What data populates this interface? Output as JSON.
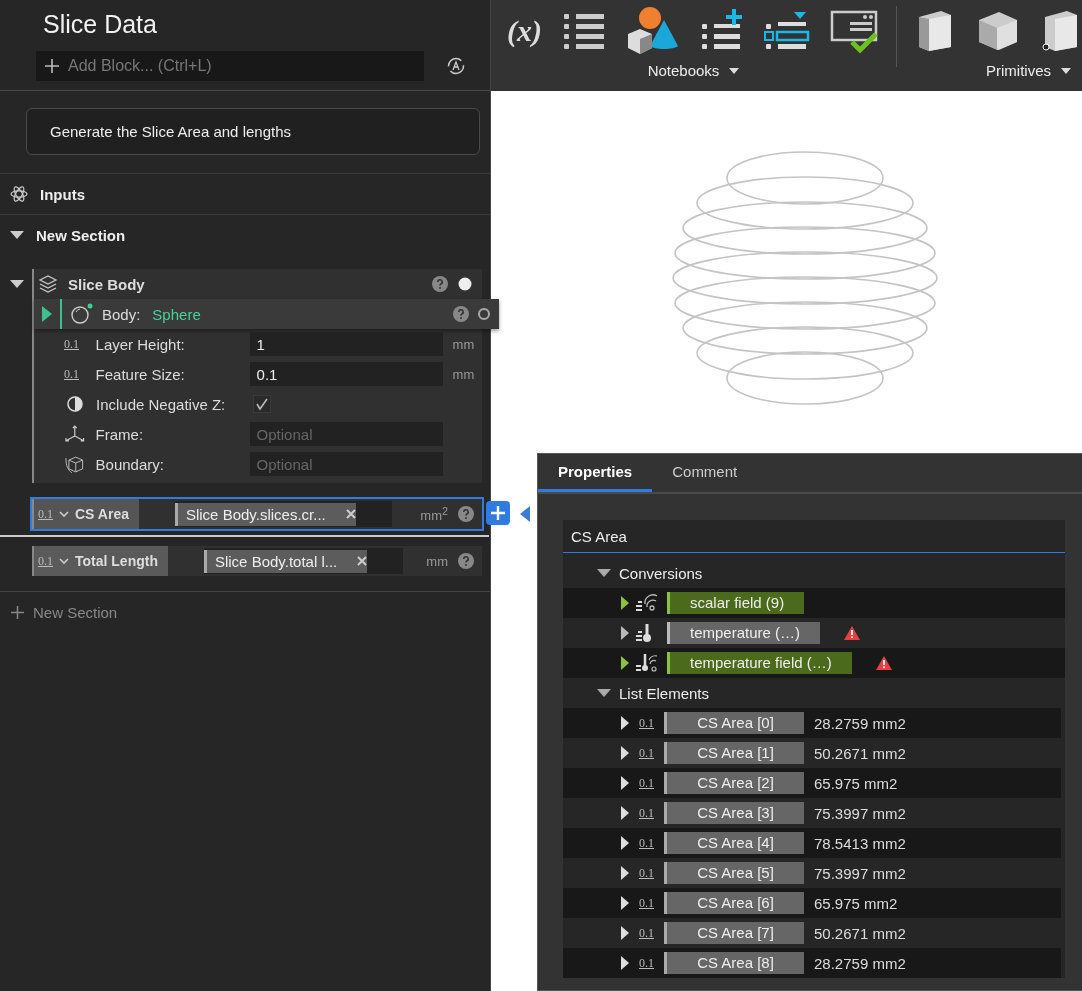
{
  "sidebar": {
    "title": "Slice Data",
    "add_block": {
      "placeholder": "Add Block... (Ctrl+L)"
    },
    "description": "Generate the Slice Area and lengths",
    "inputs_label": "Inputs",
    "section": {
      "title": "New Section",
      "expanded": true
    },
    "block": {
      "title": "Slice Body",
      "expanded": true,
      "body": {
        "label": "Body:",
        "value": "Sphere",
        "expanded": false
      },
      "params": [
        {
          "kind": "number",
          "icon": "0.1",
          "label": "Layer Height:",
          "value": "1",
          "unit": "mm"
        },
        {
          "kind": "number",
          "icon": "0.1",
          "label": "Feature Size:",
          "value": "0.1",
          "unit": "mm"
        },
        {
          "kind": "checkbox",
          "label": "Include Negative Z:",
          "checked": true
        },
        {
          "kind": "frame",
          "label": "Frame:",
          "placeholder": "Optional"
        },
        {
          "kind": "boundary",
          "label": "Boundary:",
          "placeholder": "Optional"
        }
      ]
    },
    "outputs": [
      {
        "icon": "0.1",
        "name": "CS Area",
        "expression": "Slice Body.slices.cr...",
        "unit": "mm$^{2}$",
        "selected": true
      },
      {
        "icon": "0.1",
        "name": "Total Length",
        "expression": "Slice Body.total l...",
        "unit": "mm",
        "selected": false
      }
    ],
    "new_section": "New Section"
  },
  "toolbar": {
    "formula": "(x)",
    "groups": [
      {
        "label": "Notebooks"
      },
      {
        "label": "Primitives"
      }
    ]
  },
  "properties": {
    "tabs": [
      {
        "label": "Properties",
        "selected": true
      },
      {
        "label": "Comment",
        "selected": false
      }
    ],
    "name": "CS Area",
    "conversions": {
      "title": "Conversions",
      "expanded": true,
      "items": [
        {
          "kind": "scalar_field",
          "label": "scalar field (9)",
          "available": true,
          "warning": false
        },
        {
          "kind": "temperature",
          "label": "temperature (…)",
          "available": false,
          "warning": true
        },
        {
          "kind": "temperature_field",
          "label": "temperature field (…)",
          "available": true,
          "warning": true
        }
      ]
    },
    "list": {
      "title": "List Elements",
      "expanded": true,
      "items": [
        {
          "icon": "0.1",
          "label": "CS Area [0]",
          "value": "28.2759 mm2"
        },
        {
          "icon": "0.1",
          "label": "CS Area [1]",
          "value": "50.2671 mm2"
        },
        {
          "icon": "0.1",
          "label": "CS Area [2]",
          "value": "65.975 mm2"
        },
        {
          "icon": "0.1",
          "label": "CS Area [3]",
          "value": "75.3997 mm2"
        },
        {
          "icon": "0.1",
          "label": "CS Area [4]",
          "value": "78.5413 mm2"
        },
        {
          "icon": "0.1",
          "label": "CS Area [5]",
          "value": "75.3997 mm2"
        },
        {
          "icon": "0.1",
          "label": "CS Area [6]",
          "value": "65.975 mm2"
        },
        {
          "icon": "0.1",
          "label": "CS Area [7]",
          "value": "50.2671 mm2"
        },
        {
          "icon": "0.1",
          "label": "CS Area [8]",
          "value": "28.2759 mm2"
        }
      ]
    }
  }
}
